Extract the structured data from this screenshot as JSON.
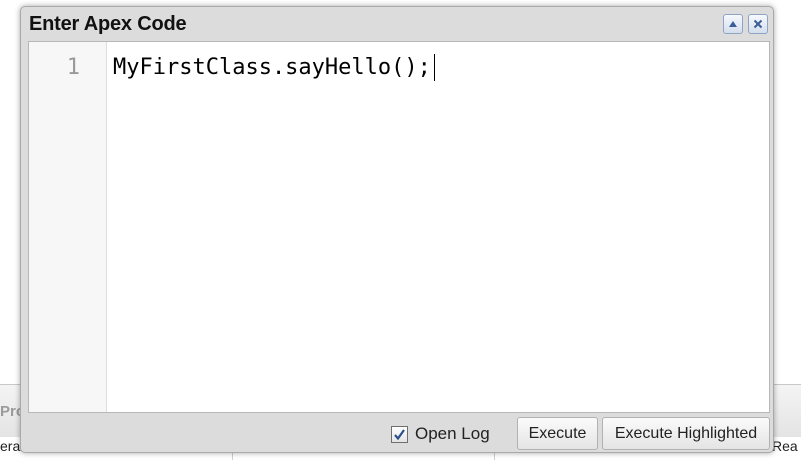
{
  "dialog": {
    "title": "Enter Apex Code",
    "collapse_icon": "triangle-up-icon",
    "close_icon": "close-icon"
  },
  "editor": {
    "lines": [
      {
        "number": "1",
        "code": "MyFirstClass.sayHello();"
      }
    ]
  },
  "footer": {
    "open_log_label": "Open Log",
    "open_log_checked": true,
    "execute_label": "Execute",
    "execute_highlighted_label": "Execute Highlighted"
  },
  "background": {
    "tab_fragment": "Pro",
    "left_cell_fragment": "era",
    "right_cell_fragment": "Rea"
  },
  "colors": {
    "dialog_bg": "#dcdcdc",
    "button_border": "#8ea4c2",
    "checkmark": "#2a4f8f"
  }
}
